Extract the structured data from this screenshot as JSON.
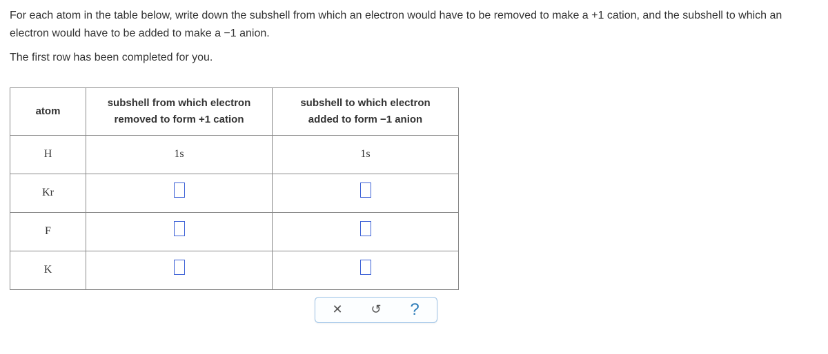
{
  "instructions": {
    "line1": "For each atom in the table below, write down the subshell from which an electron would have to be removed to make a +1 cation, and the subshell to which an electron would have to be added to make a −1 anion.",
    "line2": "The first row has been completed for you."
  },
  "table": {
    "headers": {
      "atom": "atom",
      "col1": "subshell from which electron removed to form +1 cation",
      "col2": "subshell to which electron added to form −1 anion"
    },
    "rows": [
      {
        "atom": "H",
        "remove": "1s",
        "add": "1s",
        "filled": true
      },
      {
        "atom": "Kr",
        "remove": "",
        "add": "",
        "filled": false
      },
      {
        "atom": "F",
        "remove": "",
        "add": "",
        "filled": false
      },
      {
        "atom": "K",
        "remove": "",
        "add": "",
        "filled": false
      }
    ]
  },
  "toolbar": {
    "clear": "✕",
    "reset": "↺",
    "help": "?"
  }
}
